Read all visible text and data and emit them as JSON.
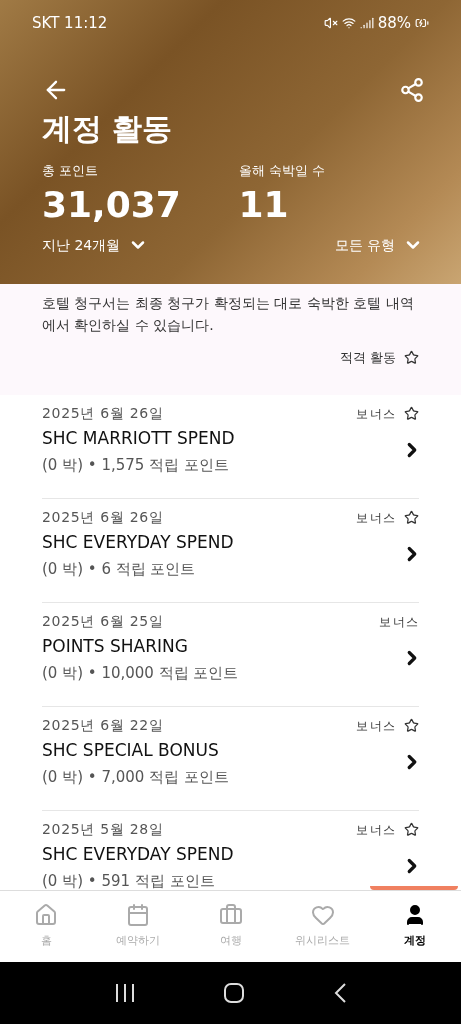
{
  "status_bar": {
    "carrier_time": "SKT 11:12",
    "battery": "88%"
  },
  "header": {
    "title": "계정 활동",
    "stats": [
      {
        "label": "총 포인트",
        "value": "31,037",
        "filter": "지난 24개월"
      },
      {
        "label": "올해 숙박일 수",
        "value": "11",
        "filter": "모든 유형"
      }
    ]
  },
  "notice": {
    "text": "호텔 청구서는 최종 청구가 확정되는 대로 숙박한 호텔 내역에서 확인하실 수 있습니다.",
    "link": "적격 활동"
  },
  "activities": [
    {
      "date": "2025년 6월 26일",
      "tag": "보너스",
      "star": true,
      "title": "SHC MARRIOTT SPEND",
      "detail": "(0 박) • 1,575 적립 포인트"
    },
    {
      "date": "2025년 6월 26일",
      "tag": "보너스",
      "star": true,
      "title": "SHC EVERYDAY SPEND",
      "detail": "(0 박) • 6 적립 포인트"
    },
    {
      "date": "2025년 6월 25일",
      "tag": "보너스",
      "star": false,
      "title": "POINTS SHARING",
      "detail": "(0 박) • 10,000 적립 포인트"
    },
    {
      "date": "2025년 6월 22일",
      "tag": "보너스",
      "star": true,
      "title": "SHC SPECIAL BONUS",
      "detail": "(0 박) • 7,000 적립 포인트"
    },
    {
      "date": "2025년 5월 28일",
      "tag": "보너스",
      "star": true,
      "title": "SHC EVERYDAY SPEND",
      "detail": "(0 박) • 591 적립 포인트"
    }
  ],
  "nav": [
    {
      "kind": "home",
      "label": "홈",
      "selected": false
    },
    {
      "kind": "calendar",
      "label": "예약하기",
      "selected": false
    },
    {
      "kind": "briefcase",
      "label": "여행",
      "selected": false
    },
    {
      "kind": "heart",
      "label": "위시리스트",
      "selected": false
    },
    {
      "kind": "person",
      "label": "계정",
      "selected": true
    }
  ]
}
